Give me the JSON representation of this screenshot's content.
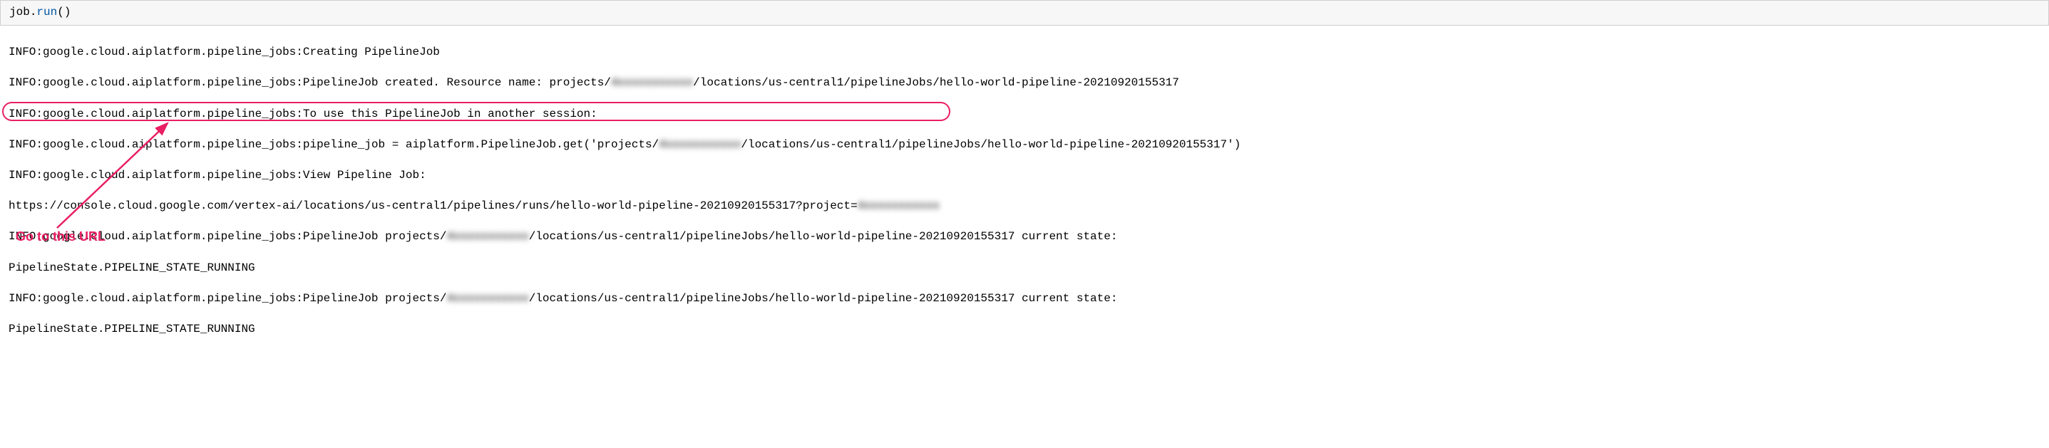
{
  "code": {
    "object": "job",
    "method": "run",
    "full": "job.run()"
  },
  "output": {
    "lines": [
      "INFO:google.cloud.aiplatform.pipeline_jobs:Creating PipelineJob",
      "INFO:google.cloud.aiplatform.pipeline_jobs:PipelineJob created. Resource name: projects/",
      "/locations/us-central1/pipelineJobs/hello-world-pipeline-20210920155317",
      "INFO:google.cloud.aiplatform.pipeline_jobs:To use this PipelineJob in another session:",
      "INFO:google.cloud.aiplatform.pipeline_jobs:pipeline_job = aiplatform.PipelineJob.get('projects/",
      "/locations/us-central1/pipelineJobs/hello-world-pipeline-20210920155317')",
      "INFO:google.cloud.aiplatform.pipeline_jobs:View Pipeline Job:",
      "https://console.cloud.google.com/vertex-ai/locations/us-central1/pipelines/runs/hello-world-pipeline-20210920155317?project=",
      "INFO:google.cloud.aiplatform.pipeline_jobs:PipelineJob projects/",
      "/locations/us-central1/pipelineJobs/hello-world-pipeline-20210920155317 current state:",
      "PipelineState.PIPELINE_STATE_RUNNING",
      "INFO:google.cloud.aiplatform.pipeline_jobs:PipelineJob projects/",
      "/locations/us-central1/pipelineJobs/hello-world-pipeline-20210920155317 current state:",
      "PipelineState.PIPELINE_STATE_RUNNING"
    ],
    "redacted_placeholder": "4xxxxxxxxxxx"
  },
  "annotation": {
    "label": "Go to this URL",
    "color": "#e91e63"
  }
}
